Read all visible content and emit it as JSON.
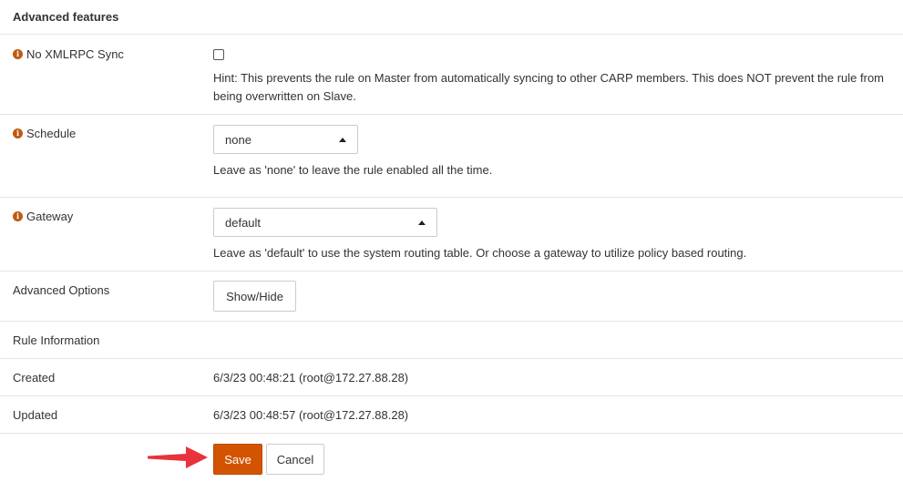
{
  "section": {
    "title": "Advanced features"
  },
  "xmlrpc": {
    "label": "No XMLRPC Sync",
    "hint": "Hint: This prevents the rule on Master from automatically syncing to other CARP members. This does NOT prevent the rule from being overwritten on Slave."
  },
  "schedule": {
    "label": "Schedule",
    "value": "none",
    "hint": "Leave as 'none' to leave the rule enabled all the time."
  },
  "gateway": {
    "label": "Gateway",
    "value": "default",
    "hint": "Leave as 'default' to use the system routing table. Or choose a gateway to utilize policy based routing."
  },
  "advanced_options": {
    "label": "Advanced Options",
    "button": "Show/Hide"
  },
  "rule_info": {
    "label": "Rule Information"
  },
  "created": {
    "label": "Created",
    "value": "6/3/23 00:48:21 (root@172.27.88.28)"
  },
  "updated": {
    "label": "Updated",
    "value": "6/3/23 00:48:57 (root@172.27.88.28)"
  },
  "actions": {
    "save": "Save",
    "cancel": "Cancel"
  },
  "colors": {
    "accent": "#d35400",
    "arrow": "#e8323c",
    "info_icon": "#c05a12"
  },
  "icons": {
    "info": "info-icon",
    "arrow": "arrow-right-icon",
    "caret": "caret-up-icon"
  }
}
